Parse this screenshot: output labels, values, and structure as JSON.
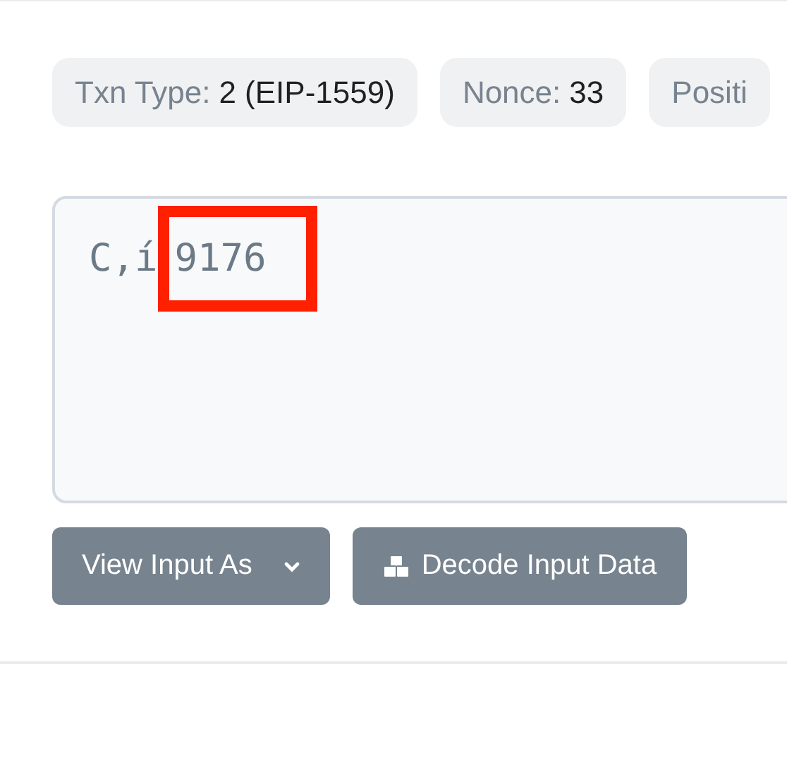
{
  "badges": [
    {
      "label": "Txn Type:",
      "value": "2 (EIP-1559)"
    },
    {
      "label": "Nonce:",
      "value": "33"
    },
    {
      "label": "Positi"
    }
  ],
  "input_data": {
    "segments": [
      {
        "text": "C,í",
        "highlighted": false
      },
      {
        "text": "9176",
        "highlighted": true
      }
    ]
  },
  "buttons": [
    {
      "label": "View Input As",
      "kind": "dropdown"
    },
    {
      "label": "Decode Input Data",
      "kind": "decode"
    }
  ]
}
